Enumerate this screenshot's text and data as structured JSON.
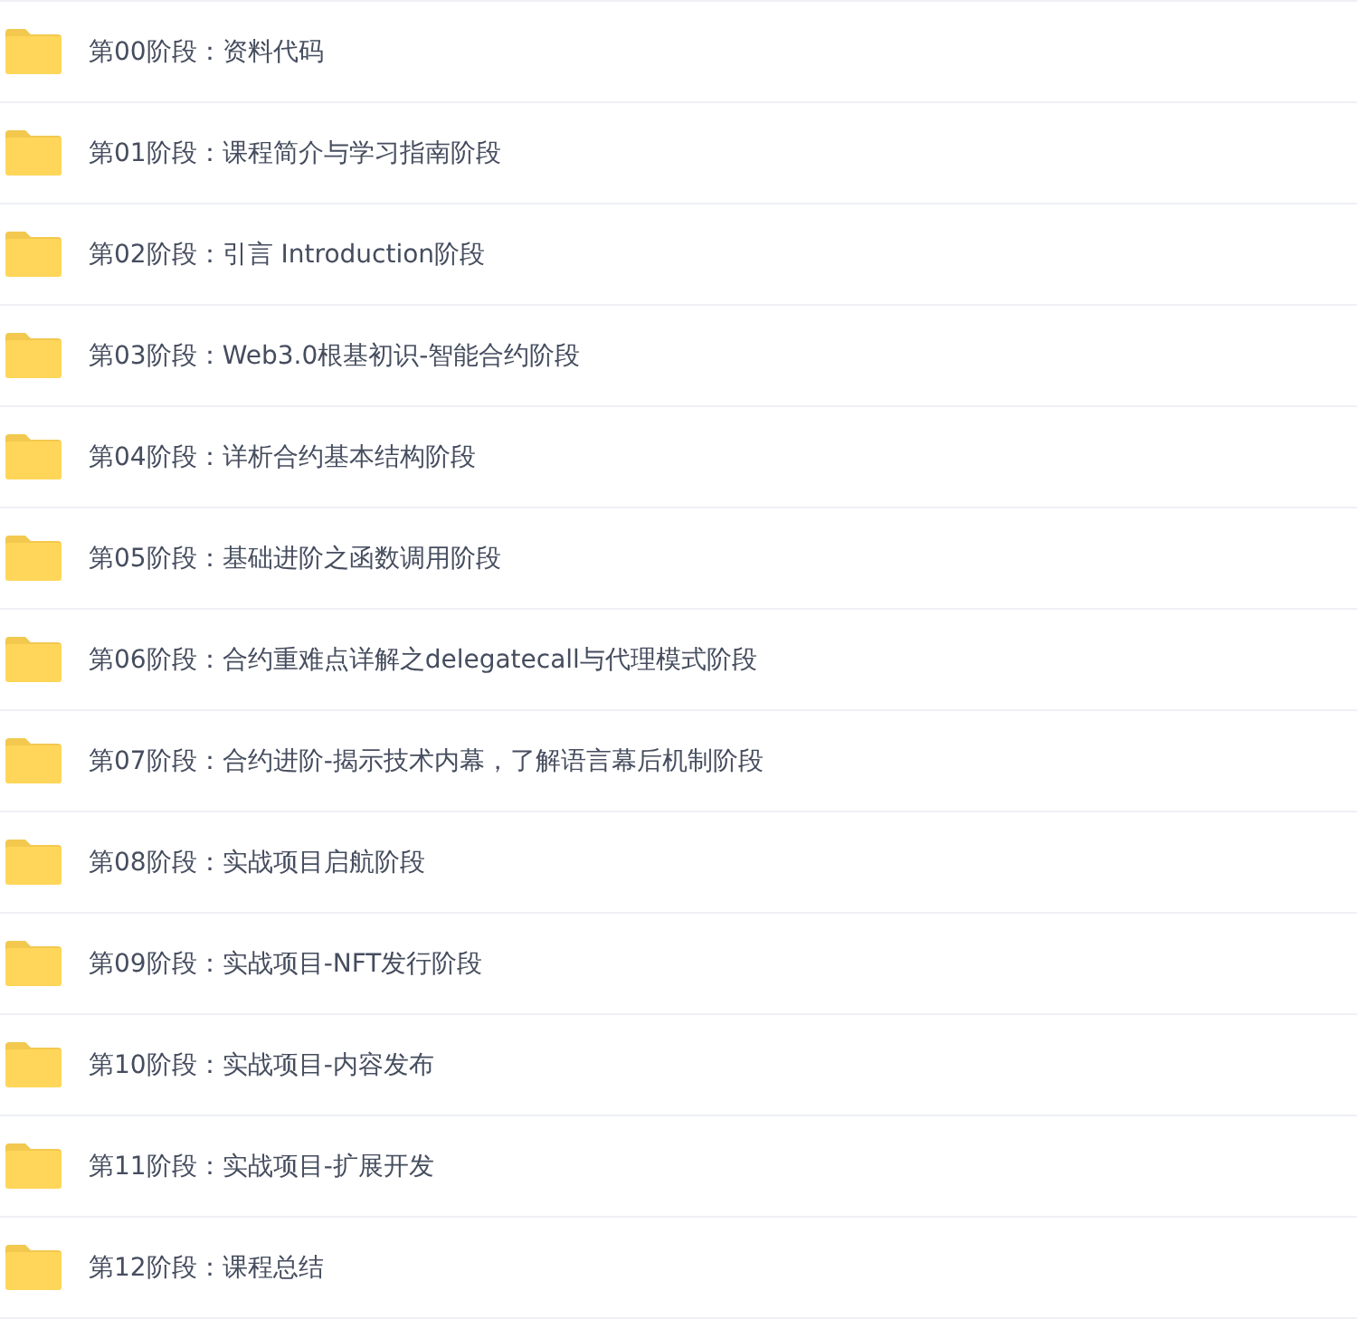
{
  "folders": [
    {
      "name": "第00阶段：资料代码"
    },
    {
      "name": "第01阶段：课程简介与学习指南阶段"
    },
    {
      "name": "第02阶段：引言 Introduction阶段"
    },
    {
      "name": "第03阶段：Web3.0根基初识-智能合约阶段"
    },
    {
      "name": "第04阶段：详析合约基本结构阶段"
    },
    {
      "name": "第05阶段：基础进阶之函数调用阶段"
    },
    {
      "name": "第06阶段：合约重难点详解之delegatecall与代理模式阶段"
    },
    {
      "name": "第07阶段：合约进阶-揭示技术内幕，了解语言幕后机制阶段"
    },
    {
      "name": "第08阶段：实战项目启航阶段"
    },
    {
      "name": "第09阶段：实战项目-NFT发行阶段"
    },
    {
      "name": "第10阶段：实战项目-内容发布"
    },
    {
      "name": "第11阶段：实战项目-扩展开发"
    },
    {
      "name": "第12阶段：课程总结"
    }
  ]
}
